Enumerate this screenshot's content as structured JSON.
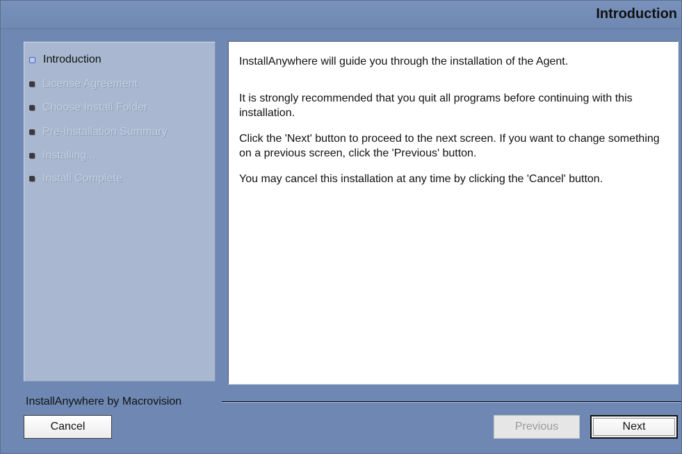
{
  "header": {
    "title": "Introduction"
  },
  "steps": [
    {
      "label": "Introduction",
      "state": "current"
    },
    {
      "label": "License Agreement",
      "state": "pending"
    },
    {
      "label": "Choose Install Folder",
      "state": "pending"
    },
    {
      "label": "Pre-Installation Summary",
      "state": "pending"
    },
    {
      "label": "Installing...",
      "state": "pending"
    },
    {
      "label": "Install Complete",
      "state": "pending"
    }
  ],
  "content": {
    "paragraphs": [
      "InstallAnywhere will guide you through the installation of the  Agent.",
      "It is strongly recommended that you quit all programs before continuing with this installation.",
      "Click the 'Next' button to proceed to the next screen. If you want to change something on a previous screen, click the 'Previous' button.",
      "You may cancel this installation at any time by clicking the 'Cancel' button."
    ]
  },
  "footer": {
    "brand": "InstallAnywhere by Macrovision",
    "cancel_label": "Cancel",
    "previous_label": "Previous",
    "previous_enabled": false,
    "next_label": "Next"
  },
  "colors": {
    "window_bg": "#6e88b3",
    "steps_panel_bg": "#a9b8d0",
    "current_step_bullet": "#4a67c8"
  }
}
